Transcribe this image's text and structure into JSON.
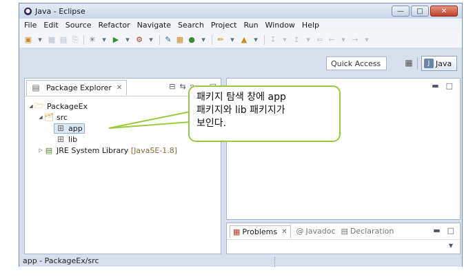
{
  "window": {
    "title": "Java - Eclipse"
  },
  "menu": [
    "File",
    "Edit",
    "Source",
    "Refactor",
    "Navigate",
    "Search",
    "Project",
    "Run",
    "Window",
    "Help"
  ],
  "toolbar": {
    "quick_access": "Quick Access",
    "perspective": "Java"
  },
  "package_explorer": {
    "title": "Package Explorer",
    "tree": {
      "project": "PackageEx",
      "src": "src",
      "packages": [
        "app",
        "lib"
      ],
      "jre_name": "JRE System Library",
      "jre_version": "[JavaSE-1.8]"
    }
  },
  "bottom_panel": {
    "tabs": [
      "Problems",
      "Javadoc",
      "Declaration"
    ]
  },
  "status": "app - PackageEx/src",
  "callout": {
    "lines": [
      "패키지 탐색 창에 app",
      "패키지와 lib 패키지가",
      "보인다."
    ]
  },
  "colors": {
    "callout_border": "#9bc93c",
    "titlebar": "#c9d7ea"
  }
}
